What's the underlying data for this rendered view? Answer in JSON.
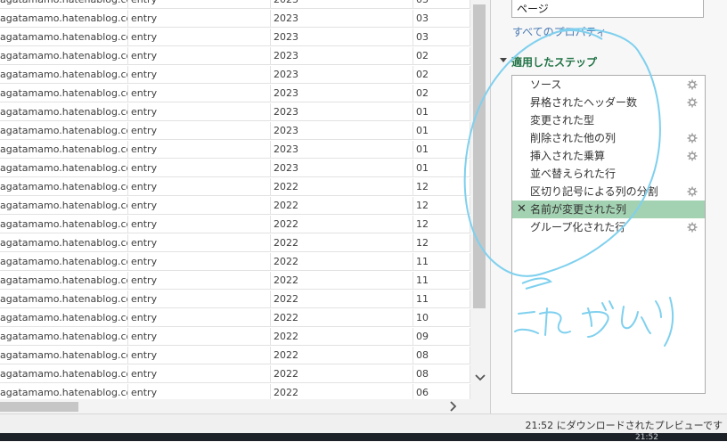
{
  "grid": {
    "rows": [
      [
        "agatamamo.hatenablog.com",
        "entry",
        "2023",
        "03"
      ],
      [
        "agatamamo.hatenablog.com",
        "entry",
        "2023",
        "03"
      ],
      [
        "agatamamo.hatenablog.com",
        "entry",
        "2023",
        "03"
      ],
      [
        "agatamamo.hatenablog.com",
        "entry",
        "2023",
        "02"
      ],
      [
        "agatamamo.hatenablog.com",
        "entry",
        "2023",
        "02"
      ],
      [
        "agatamamo.hatenablog.com",
        "entry",
        "2023",
        "02"
      ],
      [
        "agatamamo.hatenablog.com",
        "entry",
        "2023",
        "01"
      ],
      [
        "agatamamo.hatenablog.com",
        "entry",
        "2023",
        "01"
      ],
      [
        "agatamamo.hatenablog.com",
        "entry",
        "2023",
        "01"
      ],
      [
        "agatamamo.hatenablog.com",
        "entry",
        "2023",
        "01"
      ],
      [
        "agatamamo.hatenablog.com",
        "entry",
        "2022",
        "12"
      ],
      [
        "agatamamo.hatenablog.com",
        "entry",
        "2022",
        "12"
      ],
      [
        "agatamamo.hatenablog.com",
        "entry",
        "2022",
        "12"
      ],
      [
        "agatamamo.hatenablog.com",
        "entry",
        "2022",
        "12"
      ],
      [
        "agatamamo.hatenablog.com",
        "entry",
        "2022",
        "11"
      ],
      [
        "agatamamo.hatenablog.com",
        "entry",
        "2022",
        "11"
      ],
      [
        "agatamamo.hatenablog.com",
        "entry",
        "2022",
        "11"
      ],
      [
        "agatamamo.hatenablog.com",
        "entry",
        "2022",
        "10"
      ],
      [
        "agatamamo.hatenablog.com",
        "entry",
        "2022",
        "09"
      ],
      [
        "agatamamo.hatenablog.com",
        "entry",
        "2022",
        "08"
      ],
      [
        "agatamamo.hatenablog.com",
        "entry",
        "2022",
        "08"
      ],
      [
        "agatamamo.hatenablog.com",
        "entry",
        "2022",
        "06"
      ]
    ]
  },
  "query_settings": {
    "name_value": "ページ",
    "all_properties_link": "すべてのプロパティ",
    "applied_steps_title": "適用したステップ",
    "steps": [
      {
        "label": "ソース",
        "has_gear": true,
        "selected": false
      },
      {
        "label": "昇格されたヘッダー数",
        "has_gear": true,
        "selected": false
      },
      {
        "label": "変更された型",
        "has_gear": false,
        "selected": false
      },
      {
        "label": "削除された他の列",
        "has_gear": true,
        "selected": false
      },
      {
        "label": "挿入された乗算",
        "has_gear": true,
        "selected": false
      },
      {
        "label": "並べ替えられた行",
        "has_gear": false,
        "selected": false
      },
      {
        "label": "区切り記号による列の分割",
        "has_gear": true,
        "selected": false
      },
      {
        "label": "名前が変更された列",
        "has_gear": false,
        "selected": true
      },
      {
        "label": "グループ化された行",
        "has_gear": true,
        "selected": false
      }
    ],
    "delete_step_icon": "close-icon"
  },
  "status_bar": {
    "preview_text": "21:52 にダウンロードされたプレビューです"
  },
  "taskbar": {
    "clock": "21:52"
  },
  "annotation": {
    "handwritten_text": "これだけ",
    "color": "#7fd0ee"
  },
  "colors": {
    "selected_step": "#a3d2b2",
    "link": "#4a7ab3",
    "header_green": "#217346"
  }
}
